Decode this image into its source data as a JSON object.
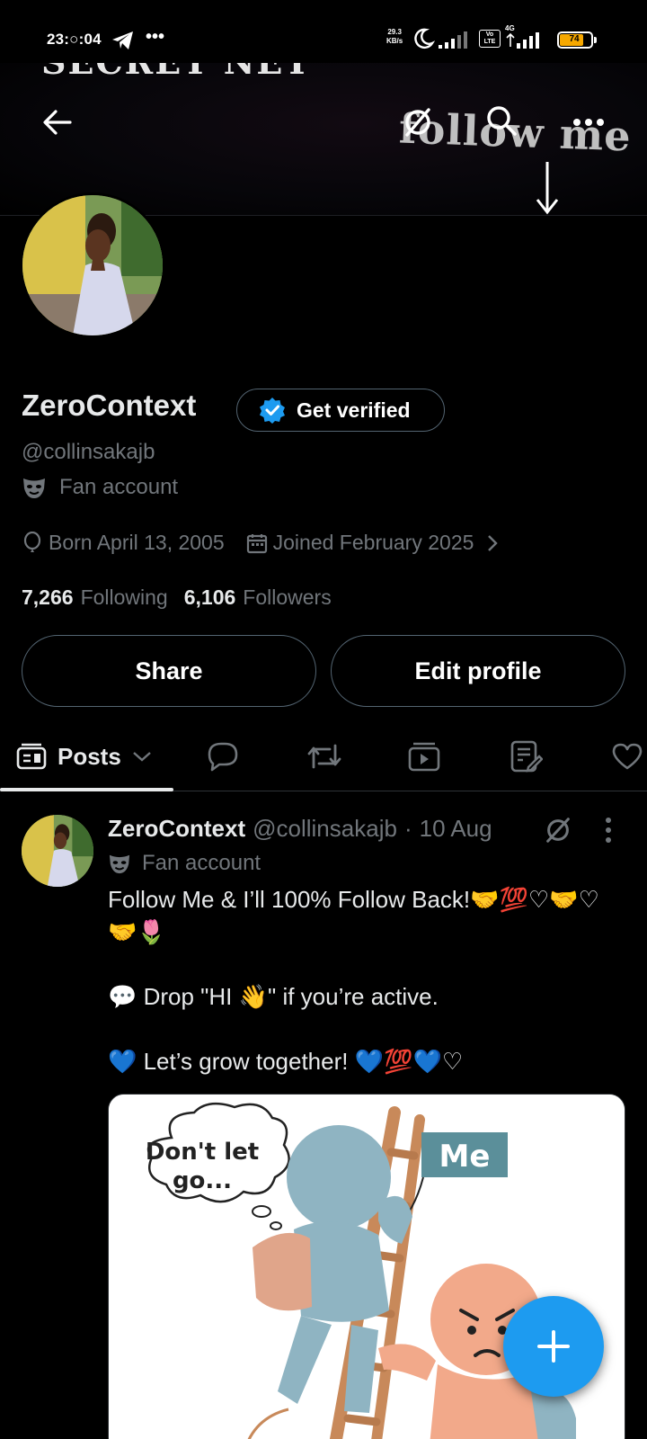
{
  "status_bar": {
    "time": "23:○:04",
    "network_speed_value": "29.3",
    "network_speed_unit": "KB/s",
    "volte_label": "Vo LTE",
    "network_type": "4G",
    "battery_level": "74"
  },
  "banner": {
    "top_text": "SECRET NET",
    "script_text": "follow me"
  },
  "profile": {
    "display_name": "ZeroContext",
    "get_verified_label": "Get verified",
    "handle": "@collinsakajb",
    "account_label": "Fan account",
    "born": "Born April 13, 2005",
    "joined": "Joined February 2025",
    "following_count": "7,266",
    "following_label": "Following",
    "followers_count": "6,106",
    "followers_label": "Followers",
    "share_label": "Share",
    "edit_profile_label": "Edit profile"
  },
  "tabs": {
    "posts_label": "Posts"
  },
  "post": {
    "author_name": "ZeroContext",
    "author_handle": "@collinsakajb",
    "separator": "·",
    "date": "10 Aug",
    "account_label": "Fan account",
    "line1": "Follow Me & I’ll 100% Follow Back!🤝💯♡🤝♡",
    "line2": "🤝🌷",
    "line3": "💬 Drop \"HI 👋\" if you’re active.",
    "line4": "💙 Let’s grow together!  💙💯💙♡",
    "media": {
      "bubble_text_1": "Don't let",
      "bubble_text_2": "go...",
      "sign_text": "Me"
    }
  },
  "icons": {
    "back": "back-arrow-icon",
    "grok": "grok-icon",
    "search": "search-icon",
    "more": "more-horizontal-icon",
    "verified": "verified-badge-icon",
    "mask": "mask-icon",
    "birthday": "balloon-icon",
    "calendar": "calendar-icon",
    "compose": "plus-icon"
  },
  "colors": {
    "background": "#000000",
    "primary_text": "#e7e9ea",
    "secondary_text": "#71767b",
    "accent_blue": "#1d9bf0",
    "border": "#536471",
    "battery": "#f6a800"
  }
}
